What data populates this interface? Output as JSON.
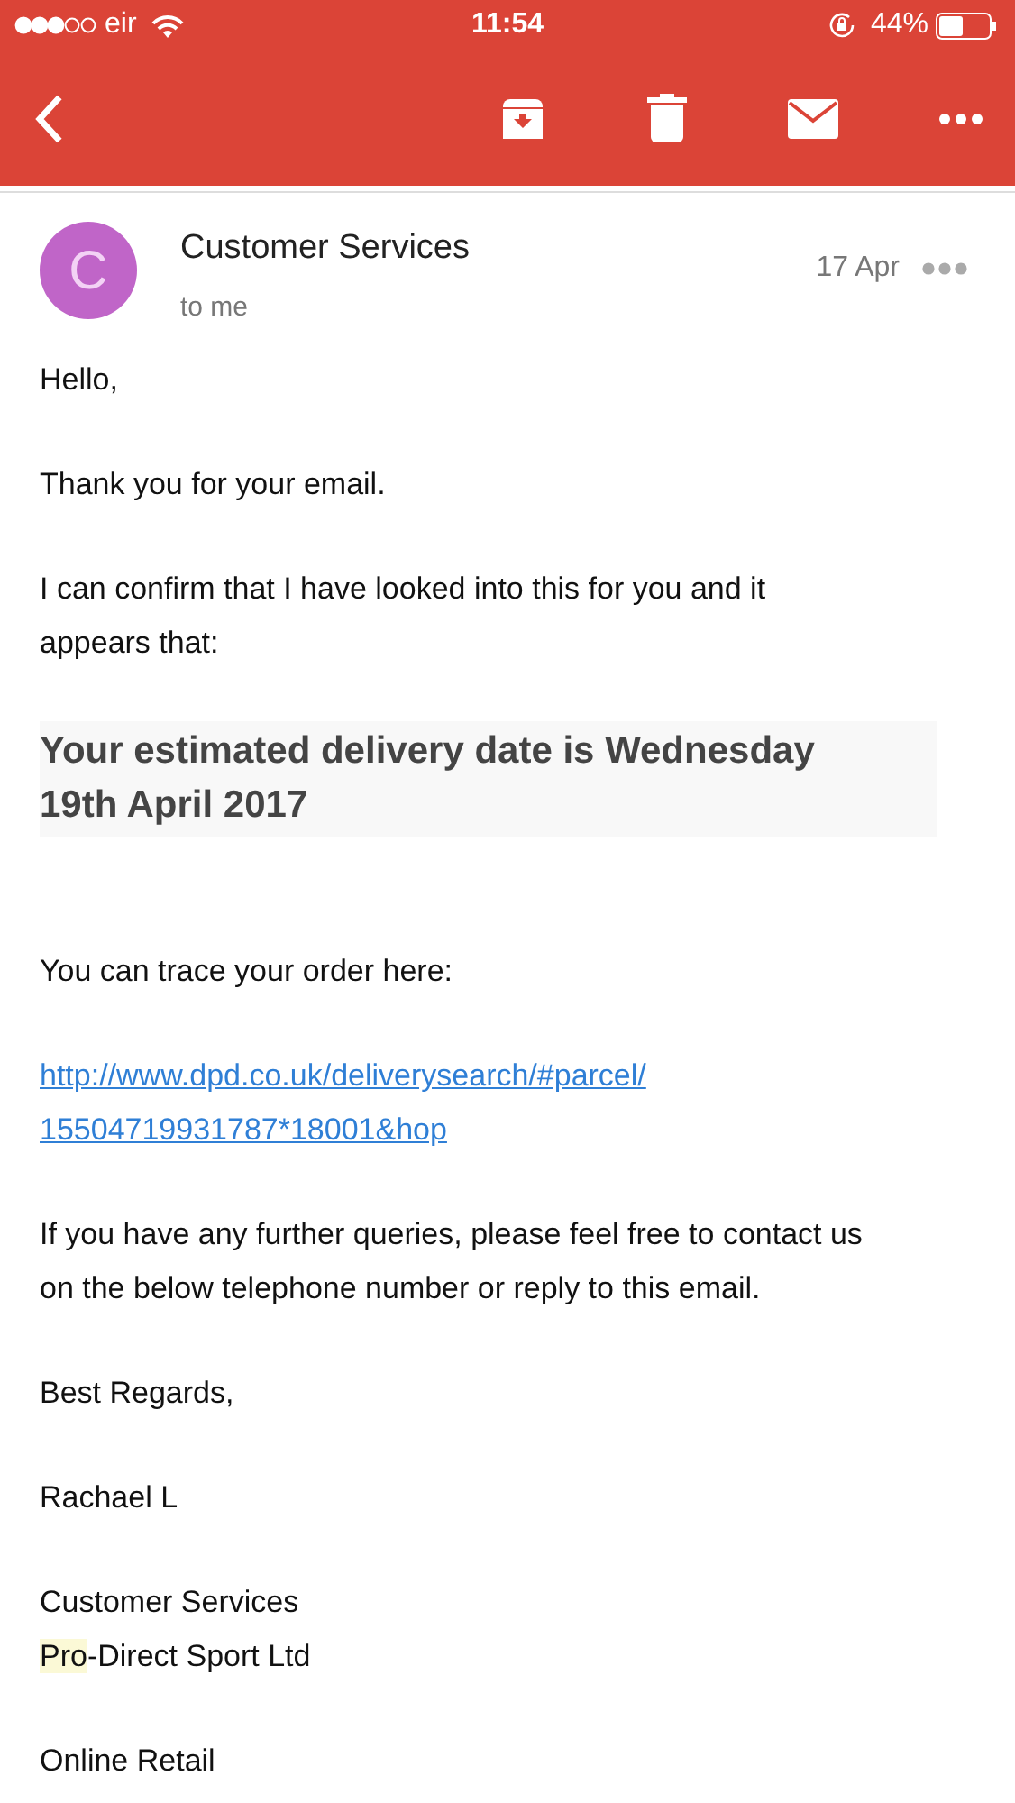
{
  "status_bar": {
    "carrier": "eir",
    "time": "11:54",
    "battery": "44%"
  },
  "toolbar": {
    "buttons": [
      {
        "kind": "back"
      },
      {
        "kind": "archive"
      },
      {
        "kind": "delete"
      },
      {
        "kind": "mail"
      },
      {
        "kind": "more"
      }
    ]
  },
  "message": {
    "avatar_letter": "C",
    "sender": "Customer Services",
    "recipient": "to me",
    "date": "17 Apr",
    "body": [
      {
        "kind": "text",
        "lines": [
          "Hello,"
        ]
      },
      {
        "kind": "text",
        "lines": [
          "Thank you for your email."
        ]
      },
      {
        "kind": "text",
        "lines": [
          "I can confirm that I have looked into this for you and it",
          "appears that:"
        ]
      },
      {
        "kind": "heading",
        "lines": [
          "Your estimated delivery date is Wednesday",
          "19th April 2017"
        ]
      },
      {
        "kind": "text",
        "lines": [
          "You can trace your order here:"
        ]
      },
      {
        "kind": "link",
        "lines": [
          "http://www.dpd.co.uk/deliverysearch/#parcel/",
          "15504719931787*18001&hop"
        ]
      },
      {
        "kind": "text",
        "lines": [
          "If you have any further queries, please feel free to contact us",
          "on the below telephone number or reply to this email."
        ]
      },
      {
        "kind": "text",
        "lines": [
          "Best Regards,"
        ]
      },
      {
        "kind": "text",
        "lines": [
          "Rachael L"
        ]
      },
      {
        "kind": "text",
        "lines": [
          [
            {
              "text": "Customer Services",
              "highlighted": false
            }
          ],
          [
            {
              "text": "Pro",
              "highlighted": true
            },
            {
              "text": "-Direct Sport Ltd",
              "highlighted": false
            }
          ]
        ]
      },
      {
        "kind": "text",
        "lines": [
          "Online Retail"
        ]
      }
    ]
  }
}
